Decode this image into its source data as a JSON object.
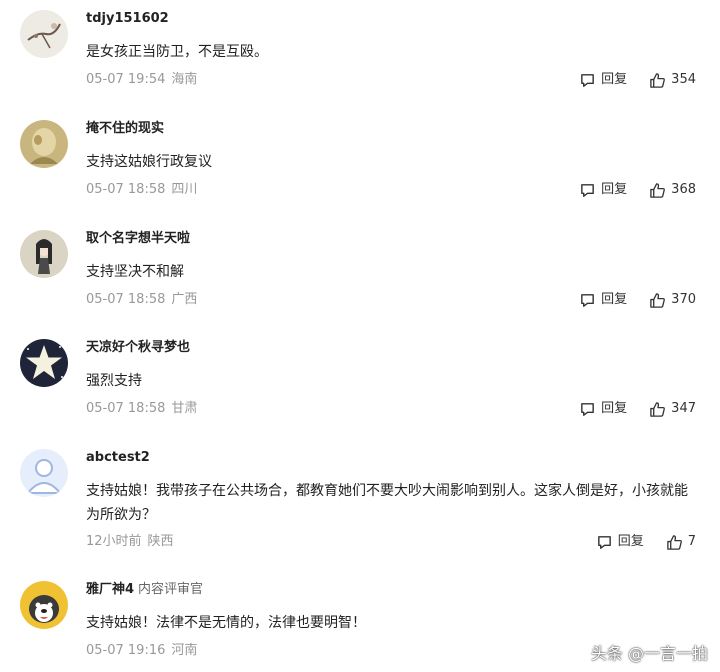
{
  "comments": [
    {
      "username": "tdjy151602",
      "badge": "",
      "text": "是女孩正当防卫，不是互殴。",
      "time": "05-07 19:54",
      "location": "海南",
      "reply_label": "回复",
      "likes": "354"
    },
    {
      "username": "掩不住的现实",
      "badge": "",
      "text": "支持这姑娘行政复议",
      "time": "05-07 18:58",
      "location": "四川",
      "reply_label": "回复",
      "likes": "368"
    },
    {
      "username": "取个名字想半天啦",
      "badge": "",
      "text": "支持坚决不和解",
      "time": "05-07 18:58",
      "location": "广西",
      "reply_label": "回复",
      "likes": "370"
    },
    {
      "username": "天凉好个秋寻梦也",
      "badge": "",
      "text": "强烈支持",
      "time": "05-07 18:58",
      "location": "甘肃",
      "reply_label": "回复",
      "likes": "347"
    },
    {
      "username": "abctest2",
      "badge": "",
      "text": "支持姑娘！我带孩子在公共场合，都教育她们不要大吵大闹影响到别人。这家人倒是好，小孩就能为所欲为？",
      "time": "12小时前",
      "location": "陕西",
      "reply_label": "回复",
      "likes": "7"
    },
    {
      "username": "雅厂神4",
      "badge": "内容评审官",
      "text": "支持姑娘！法律不是无情的，法律也要明智！",
      "time": "05-07 19:16",
      "location": "河南",
      "reply_label": "回复",
      "likes": ""
    }
  ],
  "watermark": "头条 @一言一拍",
  "icons": {
    "reply": "comment-bubble-icon",
    "like": "thumbs-up-icon"
  }
}
